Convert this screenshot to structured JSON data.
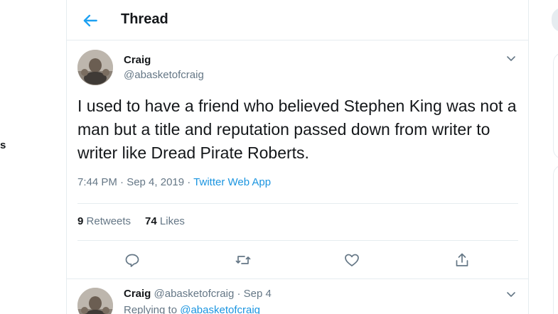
{
  "left_fragment": "s",
  "header": {
    "title": "Thread",
    "back_icon": "arrow-left-icon",
    "accent": "#1da1f2"
  },
  "tweet": {
    "name": "Craig",
    "handle": "@abasketofcraig",
    "text": "I used to have a friend who believed Stephen King was not a man but a title and reputation passed down from writer to writer like Dread Pirate Roberts.",
    "time_date": "7:44 PM · Sep 4, 2019 · ",
    "source": "Twitter Web App",
    "retweets_count": "9",
    "retweets_label": "Retweets",
    "likes_count": "74",
    "likes_label": "Likes",
    "actions": [
      "reply-icon",
      "retweet-icon",
      "like-icon",
      "share-icon"
    ]
  },
  "reply": {
    "name": "Craig",
    "handle_date": "@abasketofcraig · Sep 4",
    "replying_prefix": "Replying to ",
    "replying_handle": "@abasketofcraig"
  },
  "colors": {
    "text": "#14171a",
    "muted": "#657786",
    "link": "#1b95e0",
    "border": "#e6ecf0"
  }
}
